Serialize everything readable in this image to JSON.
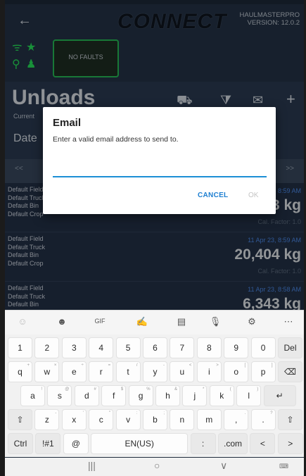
{
  "topbar": {
    "back_icon": "back-arrow-icon",
    "logo": "CONNECT",
    "app_name": "HAULMASTERPRO",
    "version": "VERSION: 12.0.2"
  },
  "status": {
    "fault_text": "NO FAULTS",
    "accent": "#28e85c"
  },
  "page": {
    "title": "Unloads",
    "current_label": "Current",
    "date_label": "Date"
  },
  "pager": {
    "prev": "<<",
    "next": ">>"
  },
  "rows": [
    {
      "field": "Default Field",
      "truck": "Default Truck",
      "bin": "Default Bin",
      "crop": "Default Crop",
      "date": "11 Apr 23, 8:59 AM",
      "weight": "13 kg",
      "cal": "Cal. Factor: 1.0"
    },
    {
      "field": "Default Field",
      "truck": "Default Truck",
      "bin": "Default Bin",
      "crop": "Default Crop",
      "date": "11 Apr 23, 8:59 AM",
      "weight": "20,404 kg",
      "cal": "Cal. Factor: 1.0"
    },
    {
      "field": "Default Field",
      "truck": "Default Truck",
      "bin": "Default Bin",
      "crop": "",
      "date": "11 Apr 23, 8:58 AM",
      "weight": "6,343 kg",
      "cal": ""
    }
  ],
  "dialog": {
    "title": "Email",
    "message": "Enter a valid email address to send to.",
    "input_value": "",
    "cancel": "CANCEL",
    "ok": "OK"
  },
  "keyboard": {
    "row1": [
      "1",
      "2",
      "3",
      "4",
      "5",
      "6",
      "7",
      "8",
      "9",
      "0",
      "Del"
    ],
    "row2": [
      "q",
      "w",
      "e",
      "r",
      "t",
      "y",
      "u",
      "i",
      "o",
      "p",
      "⌫"
    ],
    "row2_sup": [
      "+",
      "×",
      "÷",
      "=",
      "/",
      "-",
      "<",
      ">",
      "[",
      "]",
      ""
    ],
    "row3": [
      "a",
      "s",
      "d",
      "f",
      "g",
      "h",
      "j",
      "k",
      "l",
      "↵"
    ],
    "row3_sup": [
      "!",
      "@",
      "#",
      "$",
      "%",
      "&",
      "*",
      "(",
      ")",
      ""
    ],
    "row4": [
      "⇧",
      "z",
      "x",
      "c",
      "v",
      "b",
      "n",
      "m",
      ",",
      ".",
      "⇧"
    ],
    "row4_sup": [
      "",
      "-",
      "'",
      "\"",
      ":",
      ";",
      "",
      "",
      ".",
      "?",
      ""
    ],
    "row5": [
      "Ctrl",
      "!#1",
      "@",
      "EN(US)",
      ":",
      ".com",
      "<",
      ">"
    ]
  }
}
